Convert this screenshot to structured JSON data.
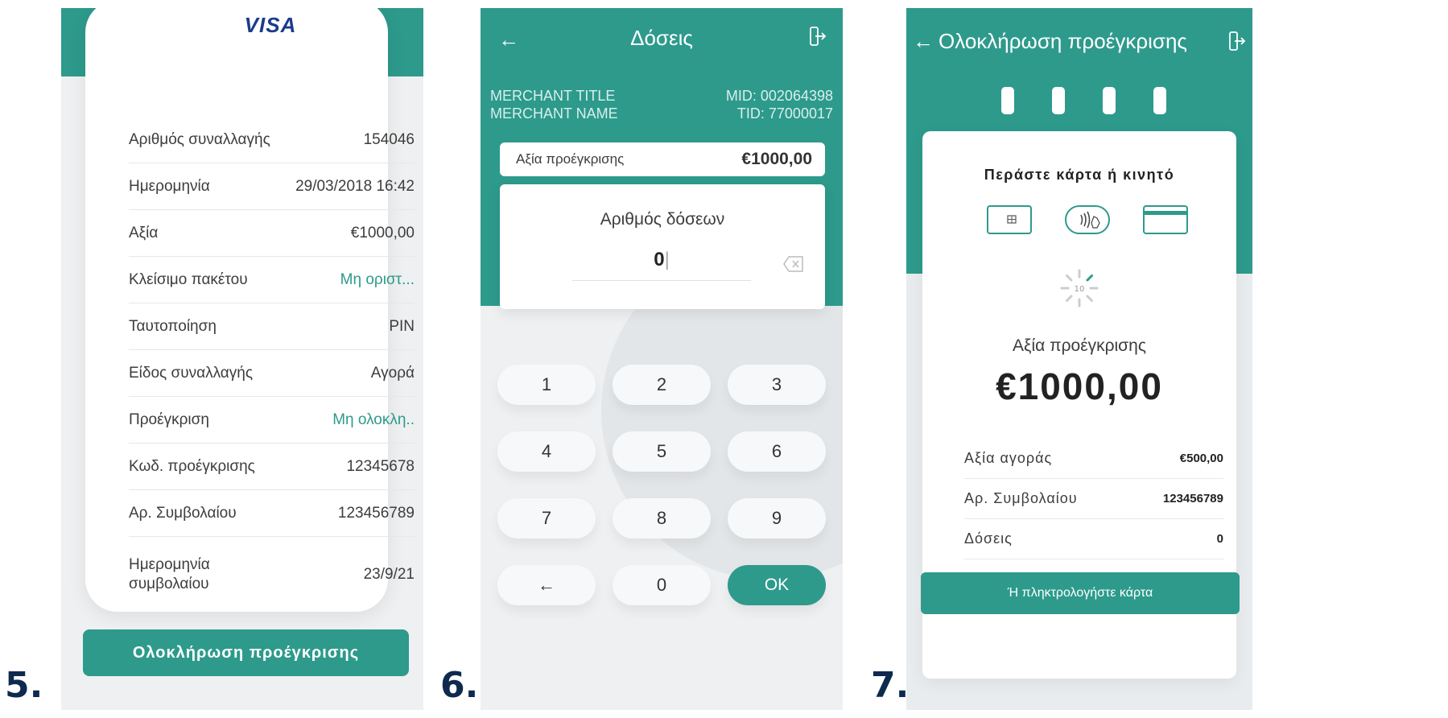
{
  "colors": {
    "teal": "#2d9a8c",
    "step_number": "#0e2a4e",
    "visa_blue": "#1a3c8c"
  },
  "steps": {
    "five": "5.",
    "six": "6.",
    "seven": "7."
  },
  "screen5": {
    "card_brand": "VISA",
    "rows": [
      {
        "label": "Αριθμός συναλλαγής",
        "value": "154046"
      },
      {
        "label": "Ημερομηνία",
        "value": "29/03/2018  16:42"
      },
      {
        "label": "Αξία",
        "value": "€1000,00"
      },
      {
        "label": "Κλείσιμο πακέτου",
        "value": "Μη οριστ..."
      },
      {
        "label": "Ταυτοποίηση",
        "value": "PIN"
      },
      {
        "label": "Είδος συναλλαγής",
        "value": "Αγορά"
      },
      {
        "label": "Προέγκριση",
        "value": "Μη ολοκλη.."
      },
      {
        "label": "Κωδ. προέγκρισης",
        "value": "12345678"
      },
      {
        "label": "Αρ. Συμβολαίου",
        "value": "123456789"
      },
      {
        "label_line1": "Ημερομηνία",
        "label_line2": "συμβολαίου",
        "value": "23/9/21"
      }
    ],
    "button": "Ολοκλήρωση προέγκρισης"
  },
  "screen6": {
    "title": "Δόσεις",
    "merchant_title": "MERCHANT TITLE",
    "merchant_name": "MERCHANT NAME",
    "mid": "MID: 002064398",
    "tid": "TID: 77000017",
    "amount_label": "Αξία προέγκρισης",
    "amount_value": "€1000,00",
    "entry_label": "Αριθμός δόσεων",
    "entry_value": "0",
    "keys": [
      "1",
      "2",
      "3",
      "4",
      "5",
      "6",
      "7",
      "8",
      "9",
      "←",
      "0",
      "OK"
    ]
  },
  "screen7": {
    "title": "Ολοκλήρωση προέγκρισης",
    "prompt": "Περάστε κάρτα ή κινητό",
    "countdown": "10",
    "amount_label": "Αξία προέγκρισης",
    "amount_value": "€1000,00",
    "rows": [
      {
        "label": "Αξία αγοράς",
        "value": "€500,00"
      },
      {
        "label": "Αρ. Συμβολαίου",
        "value": "123456789"
      },
      {
        "label": "Δόσεις",
        "value": "0"
      }
    ],
    "button": "Ή πληκτρολογήστε κάρτα",
    "icons": [
      "chip-card-icon",
      "contactless-icon",
      "magstripe-card-icon"
    ]
  }
}
